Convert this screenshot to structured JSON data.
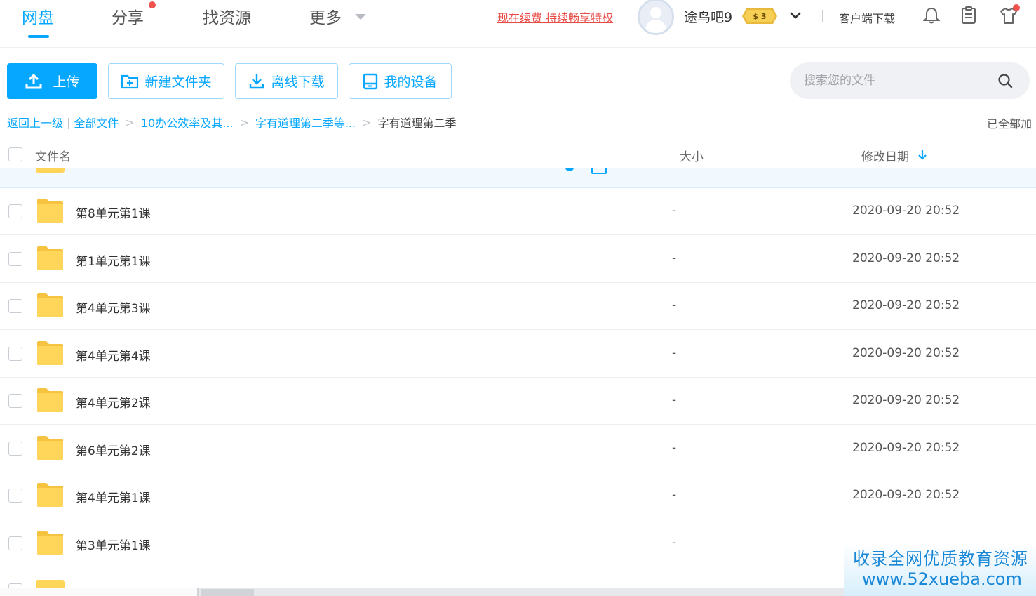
{
  "nav": {
    "tabs": [
      {
        "label": "网盘",
        "active": true
      },
      {
        "label": "分享",
        "has_dot": true
      },
      {
        "label": "找资源"
      },
      {
        "label": "更多"
      }
    ],
    "promo": "现在续费 持续畅享特权",
    "username": "途鸟吧9",
    "vip_badge": "$ 3",
    "client_download": "客户端下载",
    "icons": [
      "bell-icon",
      "clipboard-icon",
      "shirt-icon"
    ]
  },
  "toolbar": {
    "upload": "上传",
    "new_folder": "新建文件夹",
    "offline_download": "离线下载",
    "my_devices": "我的设备",
    "search_placeholder": "搜索您的文件"
  },
  "breadcrumb": {
    "back": "返回上一级",
    "items": [
      "全部文件",
      "10办公效率及其...",
      "字有道理第二季等..."
    ],
    "current": "字有道理第二季"
  },
  "status": {
    "loaded_all": "已全部加"
  },
  "table": {
    "columns": {
      "name": "文件名",
      "size": "大小",
      "modified": "修改日期"
    },
    "rows": [
      {
        "name": "第8单元第1课",
        "size": "-",
        "date": "2020-09-20 20:52"
      },
      {
        "name": "第1单元第1课",
        "size": "-",
        "date": "2020-09-20 20:52"
      },
      {
        "name": "第4单元第3课",
        "size": "-",
        "date": "2020-09-20 20:52"
      },
      {
        "name": "第4单元第4课",
        "size": "-",
        "date": "2020-09-20 20:52"
      },
      {
        "name": "第4单元第2课",
        "size": "-",
        "date": "2020-09-20 20:52"
      },
      {
        "name": "第6单元第2课",
        "size": "-",
        "date": "2020-09-20 20:52"
      },
      {
        "name": "第4单元第1课",
        "size": "-",
        "date": "2020-09-20 20:52"
      },
      {
        "name": "第3单元第1课",
        "size": "-",
        "date": ""
      }
    ]
  },
  "watermark": {
    "line1": "收录全网优质教育资源",
    "line2": "www.52xueba.com"
  },
  "colors": {
    "accent": "#06a7ff",
    "folder": "#ffd55a",
    "promo": "#e84b46",
    "dot": "#f0534f"
  }
}
